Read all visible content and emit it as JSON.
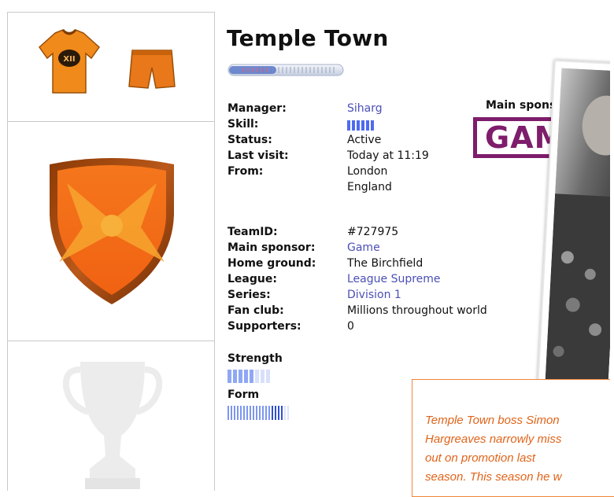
{
  "team": {
    "name": "Temple Town"
  },
  "manager": {
    "label": "Manager:",
    "value": "Siharg",
    "skill_label": "Skill:",
    "skill_level": 6,
    "status_label": "Status:",
    "status_value": "Active",
    "last_visit_label": "Last visit:",
    "last_visit_value": "Today at 11:19",
    "from_label": "From:",
    "from_city": "London",
    "from_country": "England"
  },
  "details": {
    "teamid_label": "TeamID:",
    "teamid_value": "#727975",
    "sponsor_label": "Main sponsor:",
    "sponsor_value": "Game",
    "ground_label": "Home ground:",
    "ground_value": "The Birchfield",
    "league_label": "League:",
    "league_value": "League Supreme",
    "series_label": "Series:",
    "series_value": "Division 1",
    "fanclub_label": "Fan club:",
    "fanclub_value": "Millions throughout world",
    "supporters_label": "Supporters:",
    "supporters_value": "0"
  },
  "strength": {
    "label": "Strength",
    "level_fraction": 0.625
  },
  "form": {
    "label": "Form",
    "level_fraction": 0.9
  },
  "sponsor_panel": {
    "heading": "Main sponsor",
    "logo_text": "GAME"
  },
  "caption": {
    "line1": "Temple Town boss Simon",
    "line2": "Hargreaves narrowly miss",
    "line3": "out on promotion last",
    "line4": "season. This season he w"
  },
  "colors": {
    "kit_orange": "#f08a1a",
    "link_blue": "#4a4fb8",
    "sponsor_purple": "#7e1d6b",
    "caption_orange": "#e0641a"
  },
  "icons": [
    "shirt-icon",
    "shorts-icon",
    "club-crest-icon",
    "trophy-icon"
  ]
}
